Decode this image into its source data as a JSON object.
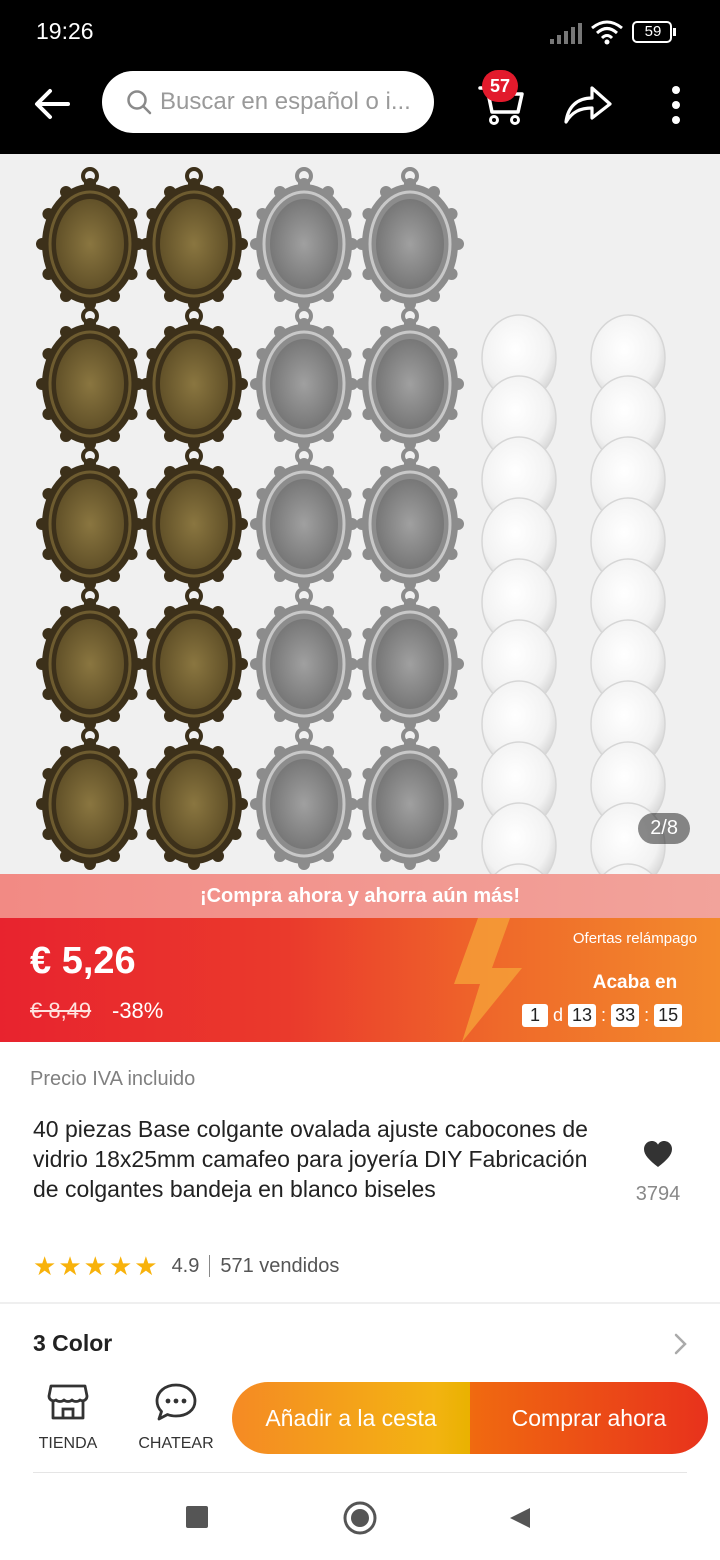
{
  "status_bar": {
    "time": "19:26",
    "battery": "59"
  },
  "header": {
    "search_placeholder": "Buscar en español o i...",
    "cart_count": "57"
  },
  "gallery": {
    "page_indicator": "2/8"
  },
  "promo": {
    "banner": "¡Compra ahora y ahorra aún más!"
  },
  "price": {
    "current": "€ 5,26",
    "original": "€ 8,49",
    "discount": "-38%"
  },
  "flash_deal": {
    "title": "Ofertas relámpago",
    "ends_label": "Acaba en",
    "days": "1",
    "day_unit": "d",
    "hours": "13",
    "minutes": "33",
    "seconds": "15"
  },
  "product": {
    "tax_note": "Precio IVA incluido",
    "title": "40 piezas Base colgante ovalada ajuste cabocones de vidrio 18x25mm camafeo para joyería DIY Fabricación de colgantes bandeja en blanco biseles",
    "favorites_count": "3794",
    "rating": "4.9",
    "sold": "571 vendidos"
  },
  "variant": {
    "label": "3 Color"
  },
  "actions": {
    "store_label": "TIENDA",
    "chat_label": "CHATEAR",
    "add_to_cart": "Añadir a la cesta",
    "buy_now": "Comprar ahora"
  },
  "colors": {
    "header_bg": "#000000",
    "sale_red": "#e8232e",
    "sale_orange": "#f38a2c",
    "star": "#f8b20b",
    "buy_now": "#e8321c",
    "add_cart": "#f3b312"
  }
}
